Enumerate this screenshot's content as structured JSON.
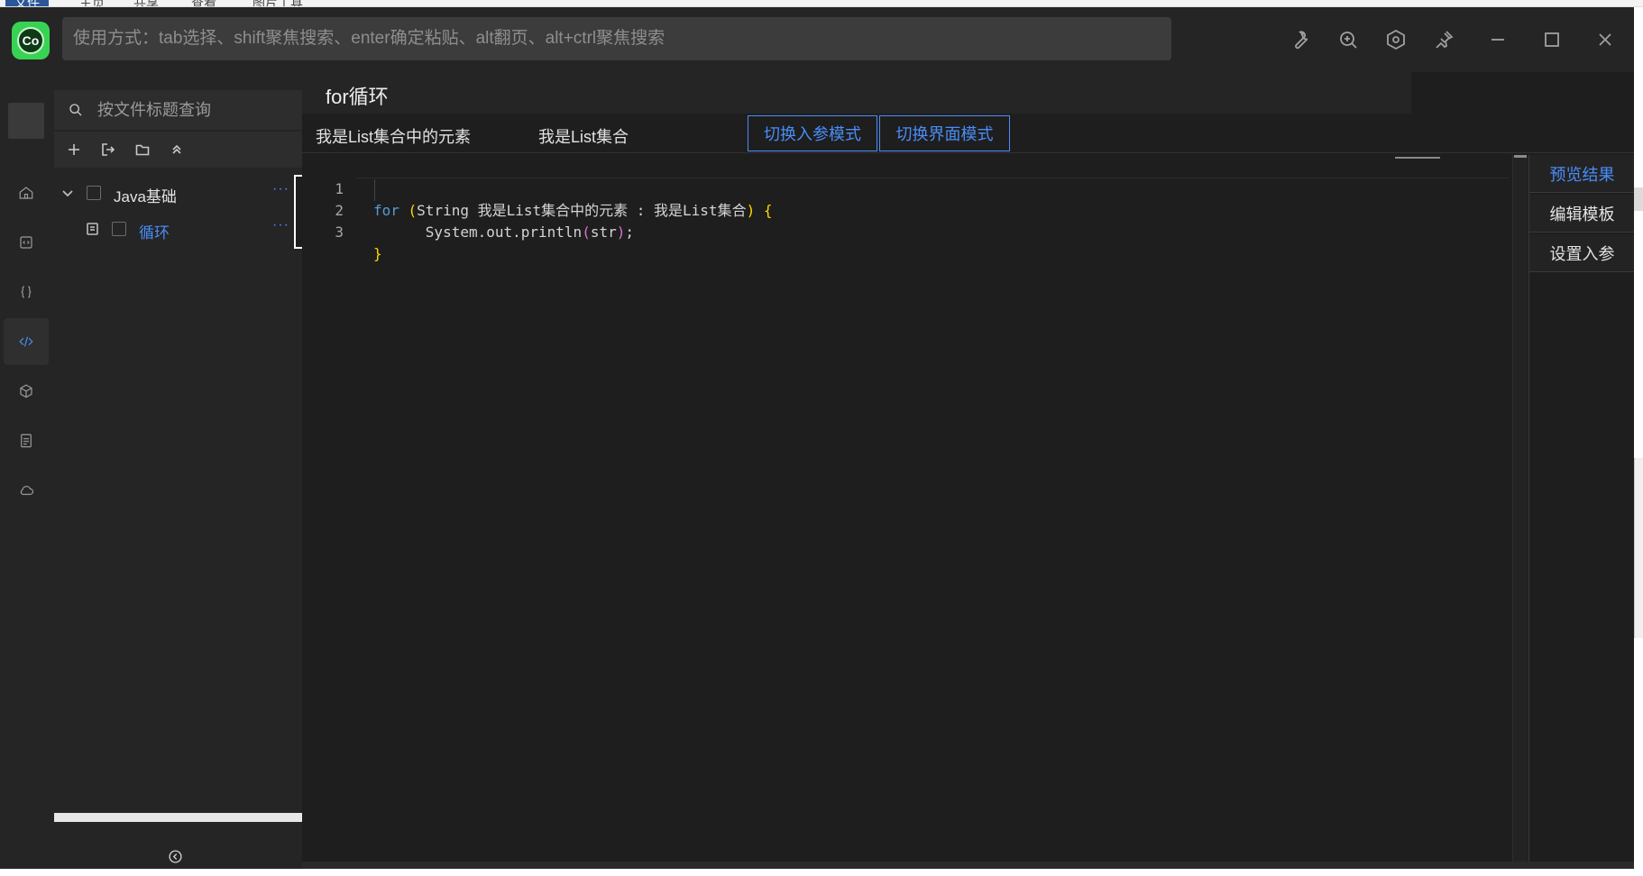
{
  "background_app": {
    "tabs": [
      "文件",
      "主页",
      "共享",
      "查看",
      "图片工具"
    ]
  },
  "titlebar": {
    "logo_text": "Co",
    "search_placeholder": "使用方式：tab选择、shift聚焦搜索、enter确定粘贴、alt翻页、alt+ctrl聚焦搜索",
    "icons": [
      "wrench-icon",
      "zoom-in-icon",
      "settings-icon",
      "pin-icon",
      "minimize-icon",
      "maximize-icon",
      "close-icon"
    ]
  },
  "activity_bar": {
    "items": [
      "home-icon",
      "snippet-icon",
      "braces-icon",
      "code-icon",
      "package-icon",
      "document-icon",
      "cloud-icon"
    ],
    "active": "code-icon"
  },
  "file_panel": {
    "search_placeholder": "按文件标题查询",
    "tools": [
      "add-icon",
      "import-icon",
      "folder-icon",
      "collapse-all-icon"
    ],
    "tree": [
      {
        "label": "Java基础",
        "type": "folder",
        "expanded": true,
        "more": "···"
      },
      {
        "label": "循环",
        "type": "file",
        "selected": true,
        "more": "···"
      }
    ]
  },
  "main": {
    "title": "for循环",
    "params": [
      "我是List集合中的元素",
      "我是List集合"
    ],
    "mode_buttons": [
      "切换入参模式",
      "切换界面模式"
    ],
    "code": {
      "line_numbers": [
        "1",
        "2",
        "3"
      ],
      "line1": {
        "kw": "for",
        "open": " (",
        "body": "String 我是List集合中的元素 : 我是List集合",
        "close": ")",
        "brace": " {"
      },
      "line2": {
        "indent": "      ",
        "pre": "System.out.println",
        "open": "(",
        "arg": "str",
        "close": ")",
        "end": ";"
      },
      "line3": {
        "brace": "}"
      }
    },
    "side_actions": [
      "预览结果",
      "编辑模板",
      "设置入参"
    ],
    "active_side_action": "预览结果"
  },
  "colors": {
    "accent": "#4a8df8",
    "logo_green": "#39d353",
    "keyword": "#569cd6",
    "bracket": "#ffd700",
    "bracket_nested": "#da70d6"
  }
}
